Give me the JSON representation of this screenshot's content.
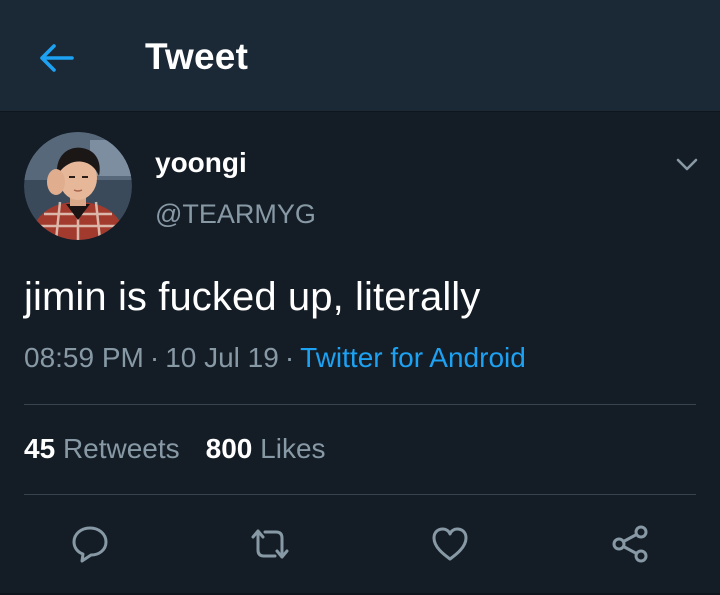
{
  "header": {
    "title": "Tweet",
    "back_icon": "arrow-left-icon"
  },
  "tweet": {
    "author": {
      "display_name": "yoongi",
      "handle": "@TEARMYG",
      "avatar": "profile-photo"
    },
    "text": "jimin is fucked up, literally",
    "time": "08:59 PM",
    "date": "10 Jul 19",
    "source": "Twitter for Android",
    "separator": "·",
    "stats": {
      "retweets_count": "45",
      "retweets_label": "Retweets",
      "likes_count": "800",
      "likes_label": "Likes"
    }
  },
  "actions": [
    {
      "name": "reply",
      "icon": "reply-icon"
    },
    {
      "name": "retweet",
      "icon": "retweet-icon"
    },
    {
      "name": "like",
      "icon": "heart-icon"
    },
    {
      "name": "share",
      "icon": "share-icon"
    }
  ],
  "colors": {
    "background": "#141d26",
    "header_bg": "#1b2836",
    "accent": "#1da1f2",
    "secondary_text": "#8899a6",
    "divider": "#38444d"
  }
}
